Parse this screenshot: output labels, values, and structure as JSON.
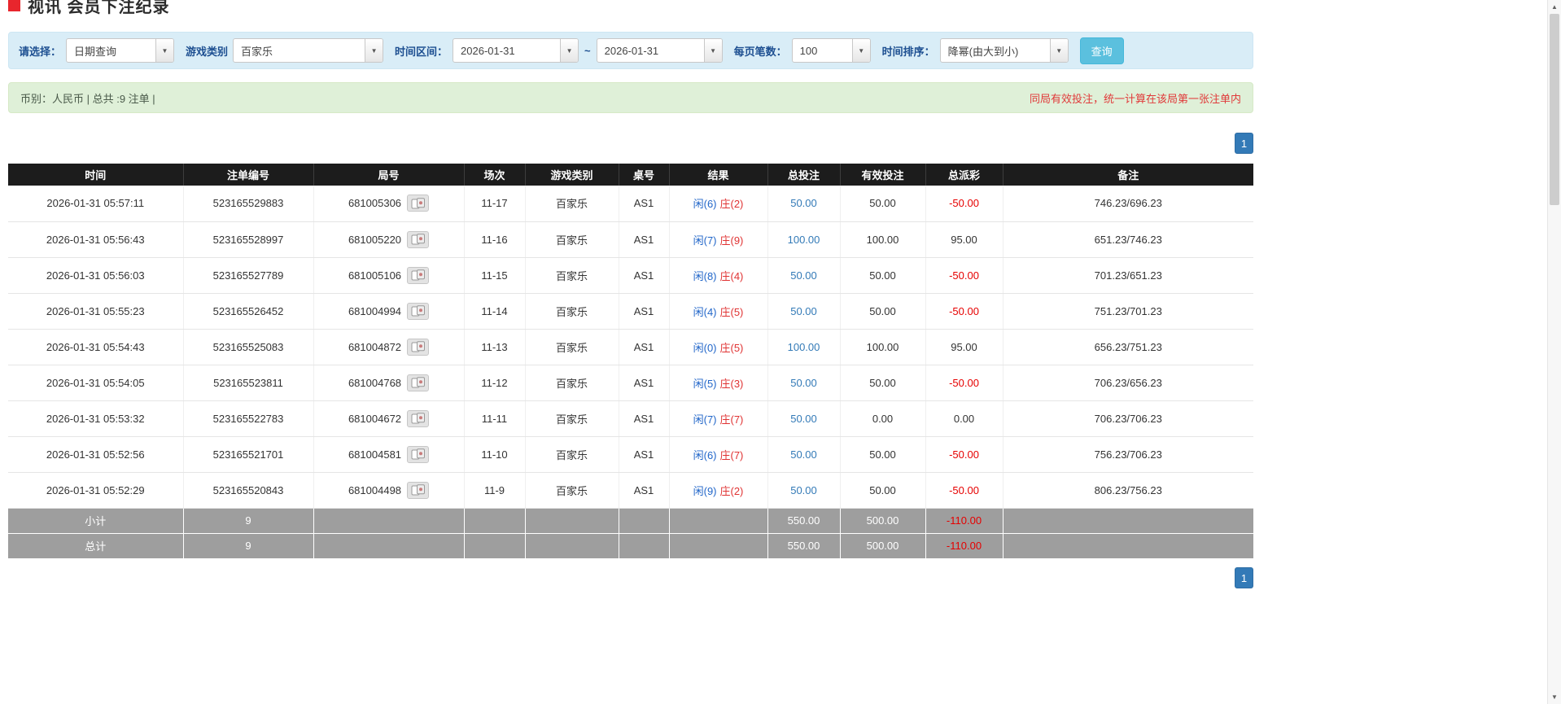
{
  "page": {
    "title": "视讯 会员下注纪录"
  },
  "colors": {
    "accent_blue": "#337ab7",
    "player_blue": "#2166c9",
    "banker_red": "#e03333",
    "negative_red": "#e60000",
    "filter_bar_bg": "#d9edf7",
    "summary_bar_bg": "#dff0d8",
    "header_bg": "#1c1c1c",
    "footer_bg": "#9e9e9e"
  },
  "filters": {
    "mode_label": "请选择：",
    "mode_value": "日期查询",
    "game_label": "游戏类别",
    "game_value": "百家乐",
    "range_label": "时间区间：",
    "date_from": "2026-01-31",
    "range_separator": "~",
    "date_to": "2026-01-31",
    "page_size_label": "每页笔数：",
    "page_size_value": "100",
    "sort_label": "时间排序：",
    "sort_value": "降幂(由大到小)",
    "query_button": "查询"
  },
  "summary": {
    "left": "币别：人民币 | 总共 :9 注单 |",
    "right": "同局有效投注，统一计算在该局第一张注单内"
  },
  "pagination": {
    "current_page": "1"
  },
  "table": {
    "headers": {
      "time": "时间",
      "bet_id": "注单编号",
      "round": "局号",
      "session": "场次",
      "game": "游戏类别",
      "table_no": "桌号",
      "result": "结果",
      "total_bet": "总投注",
      "valid_bet": "有效投注",
      "payout": "总派彩",
      "remark": "备注"
    },
    "rows": [
      {
        "time": "2026-01-31 05:57:11",
        "bet_id": "523165529883",
        "round_id": "681005306",
        "session": "11-17",
        "game": "百家乐",
        "table_no": "AS1",
        "result_player": "闲(6)",
        "result_banker": "庄(2)",
        "total_bet": "50.00",
        "valid_bet": "50.00",
        "payout": "-50.00",
        "remark": "746.23/696.23"
      },
      {
        "time": "2026-01-31 05:56:43",
        "bet_id": "523165528997",
        "round_id": "681005220",
        "session": "11-16",
        "game": "百家乐",
        "table_no": "AS1",
        "result_player": "闲(7)",
        "result_banker": "庄(9)",
        "total_bet": "100.00",
        "valid_bet": "100.00",
        "payout": "95.00",
        "remark": "651.23/746.23"
      },
      {
        "time": "2026-01-31 05:56:03",
        "bet_id": "523165527789",
        "round_id": "681005106",
        "session": "11-15",
        "game": "百家乐",
        "table_no": "AS1",
        "result_player": "闲(8)",
        "result_banker": "庄(4)",
        "total_bet": "50.00",
        "valid_bet": "50.00",
        "payout": "-50.00",
        "remark": "701.23/651.23"
      },
      {
        "time": "2026-01-31 05:55:23",
        "bet_id": "523165526452",
        "round_id": "681004994",
        "session": "11-14",
        "game": "百家乐",
        "table_no": "AS1",
        "result_player": "闲(4)",
        "result_banker": "庄(5)",
        "total_bet": "50.00",
        "valid_bet": "50.00",
        "payout": "-50.00",
        "remark": "751.23/701.23"
      },
      {
        "time": "2026-01-31 05:54:43",
        "bet_id": "523165525083",
        "round_id": "681004872",
        "session": "11-13",
        "game": "百家乐",
        "table_no": "AS1",
        "result_player": "闲(0)",
        "result_banker": "庄(5)",
        "total_bet": "100.00",
        "valid_bet": "100.00",
        "payout": "95.00",
        "remark": "656.23/751.23"
      },
      {
        "time": "2026-01-31 05:54:05",
        "bet_id": "523165523811",
        "round_id": "681004768",
        "session": "11-12",
        "game": "百家乐",
        "table_no": "AS1",
        "result_player": "闲(5)",
        "result_banker": "庄(3)",
        "total_bet": "50.00",
        "valid_bet": "50.00",
        "payout": "-50.00",
        "remark": "706.23/656.23"
      },
      {
        "time": "2026-01-31 05:53:32",
        "bet_id": "523165522783",
        "round_id": "681004672",
        "session": "11-11",
        "game": "百家乐",
        "table_no": "AS1",
        "result_player": "闲(7)",
        "result_banker": "庄(7)",
        "total_bet": "50.00",
        "valid_bet": "0.00",
        "payout": "0.00",
        "remark": "706.23/706.23"
      },
      {
        "time": "2026-01-31 05:52:56",
        "bet_id": "523165521701",
        "round_id": "681004581",
        "session": "11-10",
        "game": "百家乐",
        "table_no": "AS1",
        "result_player": "闲(6)",
        "result_banker": "庄(7)",
        "total_bet": "50.00",
        "valid_bet": "50.00",
        "payout": "-50.00",
        "remark": "756.23/706.23"
      },
      {
        "time": "2026-01-31 05:52:29",
        "bet_id": "523165520843",
        "round_id": "681004498",
        "session": "11-9",
        "game": "百家乐",
        "table_no": "AS1",
        "result_player": "闲(9)",
        "result_banker": "庄(2)",
        "total_bet": "50.00",
        "valid_bet": "50.00",
        "payout": "-50.00",
        "remark": "806.23/756.23"
      }
    ],
    "subtotal": {
      "label": "小计",
      "count": "9",
      "total_bet": "550.00",
      "valid_bet": "500.00",
      "payout": "-110.00"
    },
    "total": {
      "label": "总计",
      "count": "9",
      "total_bet": "550.00",
      "valid_bet": "500.00",
      "payout": "-110.00"
    }
  }
}
